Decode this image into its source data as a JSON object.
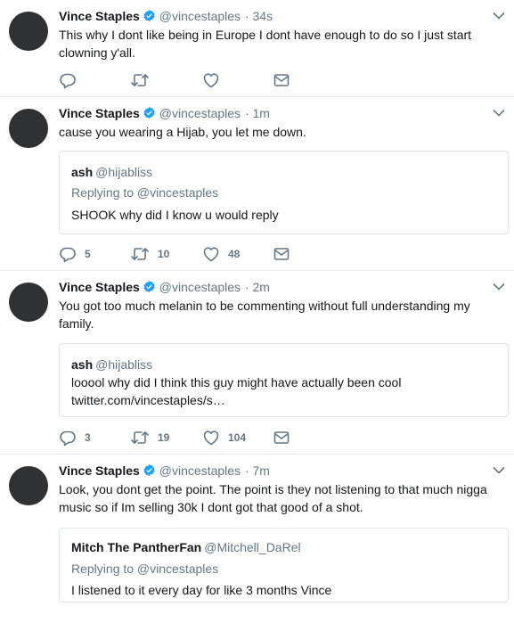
{
  "tweets": [
    {
      "name": "Vince Staples",
      "handle": "@vincestaples",
      "time": "· 34s",
      "text": "This why I dont like being in Europe I dont have enough to do so I just start clowning y'all.",
      "replies": "",
      "retweets": "",
      "likes": ""
    },
    {
      "name": "Vince Staples",
      "handle": "@vincestaples",
      "time": "· 1m",
      "text": "cause you wearing a Hijab, you let me down.",
      "quote": {
        "name": "ash",
        "handle": "@hijabliss",
        "replying_to": "Replying to @vincestaples",
        "text": "SHOOK why did I know u would reply"
      },
      "replies": "5",
      "retweets": "10",
      "likes": "48"
    },
    {
      "name": "Vince Staples",
      "handle": "@vincestaples",
      "time": "· 2m",
      "text": "You got too much melanin to be commenting without full understanding my family.",
      "quote": {
        "name": "ash",
        "handle": "@hijabliss",
        "text": "looool why did I think this guy might have actually been cool",
        "link": "twitter.com/vincestaples/s…"
      },
      "replies": "3",
      "retweets": "19",
      "likes": "104"
    },
    {
      "name": "Vince Staples",
      "handle": "@vincestaples",
      "time": "· 7m",
      "text": "Look, you dont get the point. The point is they not listening to that much nigga music so if Im selling 30k I dont got that good of a shot.",
      "quote": {
        "name": "Mitch The PantherFan",
        "handle": "@Mitchell_DaRel",
        "replying_to": "Replying to @vincestaples",
        "text": "I listened to it every day for like 3 months Vince"
      }
    }
  ],
  "colors": {
    "verified": "#1da1f2",
    "secondary": "#657786",
    "border": "#e6ecf0"
  }
}
